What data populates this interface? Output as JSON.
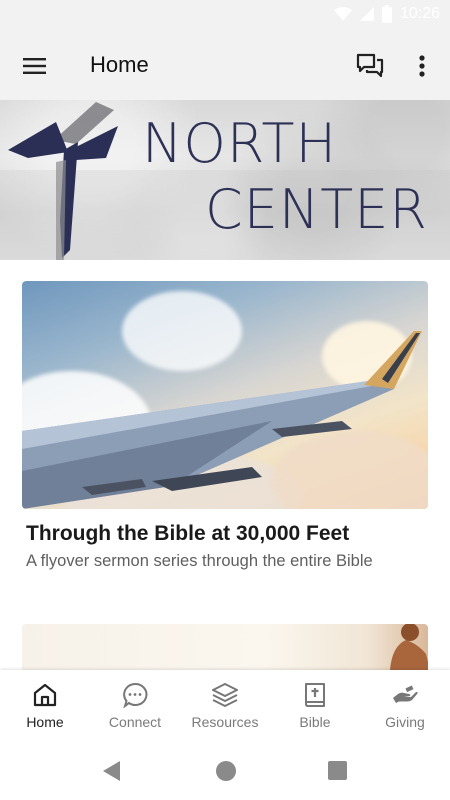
{
  "status_bar": {
    "time": "10:26"
  },
  "app_bar": {
    "title": "Home",
    "icons": [
      "menu-icon",
      "chat-icon",
      "more-vert-icon"
    ]
  },
  "banner": {
    "line1": "NORTH",
    "line2": "CENTER",
    "logo": "cross-logo",
    "text_color": "#2e3156"
  },
  "cards": [
    {
      "title": "Through the Bible at 30,000 Feet",
      "subtitle": "A flyover sermon series through the entire Bible"
    }
  ],
  "bottom_nav": {
    "items": [
      {
        "label": "Home",
        "icon": "home-icon",
        "active": true
      },
      {
        "label": "Connect",
        "icon": "chat-bubble-icon",
        "active": false
      },
      {
        "label": "Resources",
        "icon": "layers-icon",
        "active": false
      },
      {
        "label": "Bible",
        "icon": "bible-icon",
        "active": false
      },
      {
        "label": "Giving",
        "icon": "giving-hand-icon",
        "active": false
      }
    ]
  },
  "colors": {
    "app_bar_bg": "#f2f2f2",
    "active_nav": "#222222",
    "inactive_nav": "#7a7a7a"
  }
}
